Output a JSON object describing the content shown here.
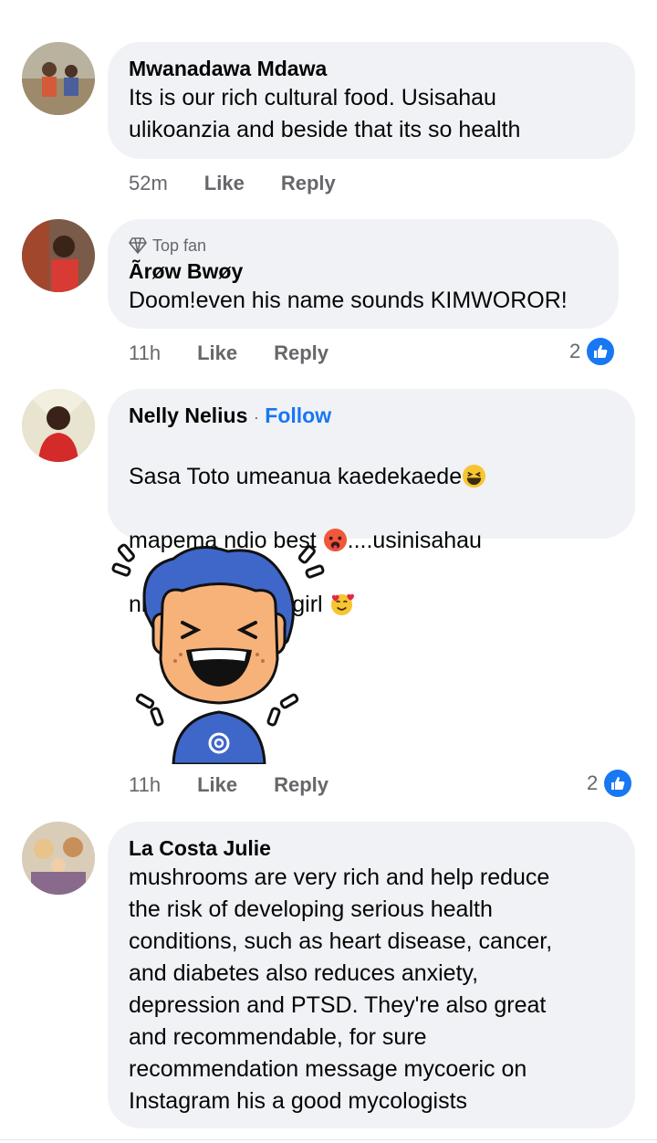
{
  "comments": [
    {
      "author": "Mwanadawa Mdawa",
      "text": "Its is our rich cultural food. Usisahau\nulikoanzia and beside that its so health",
      "time": "52m",
      "like_label": "Like",
      "reply_label": "Reply"
    },
    {
      "badge": "Top fan",
      "author": "Ãrøw Bwøy",
      "text": "Doom!even his name sounds KIMWOROR!",
      "time": "11h",
      "like_label": "Like",
      "reply_label": "Reply",
      "reaction_count": "2"
    },
    {
      "author": "Nelly Nelius",
      "separator": "·",
      "follow_label": "Follow",
      "text_line1": "Sasa Toto umeanua kaedekaede",
      "text_line2a": "mapema ndio best ",
      "text_line2b": "....usinisahau",
      "text_line3": "nitakuwa flower girl ",
      "time": "11h",
      "like_label": "Like",
      "reply_label": "Reply",
      "reaction_count": "2"
    },
    {
      "author": "La Costa Julie",
      "text": "mushrooms are very rich and help reduce\nthe risk of developing serious health\nconditions, such as heart disease, cancer,\nand diabetes also reduces anxiety,\ndepression and PTSD. They're also great\nand recommendable, for sure\nrecommendation message mycoeric on\nInstagram his a good mycologists"
    }
  ],
  "icons": {
    "like": "thumbs-up-icon",
    "top_fan": "diamond-icon"
  },
  "colors": {
    "accent": "#1877f2",
    "bubble": "#f0f2f5",
    "meta": "#65676b"
  }
}
